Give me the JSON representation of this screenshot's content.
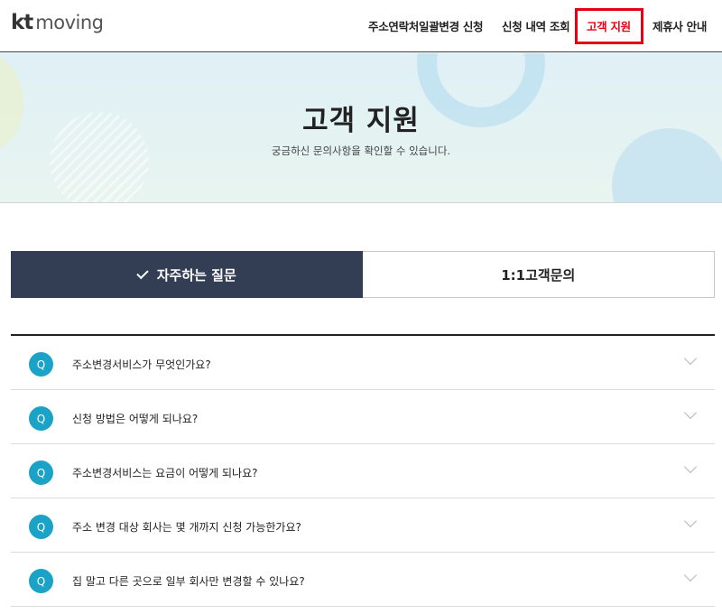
{
  "header": {
    "logo": {
      "brand": "kt",
      "product": "moving"
    },
    "nav": [
      {
        "label": "주소연락처일괄변경 신청"
      },
      {
        "label": "신청 내역 조회"
      },
      {
        "label": "고객 지원"
      },
      {
        "label": "제휴사 안내"
      }
    ],
    "accent_color": "#e60012"
  },
  "hero": {
    "title": "고객 지원",
    "subtitle": "궁금하신 문의사항을 확인할 수 있습니다."
  },
  "tabs": [
    {
      "label": "자주하는 질문",
      "selected": true
    },
    {
      "label": "1:1고객문의",
      "selected": false
    }
  ],
  "faq": {
    "badge": "Q",
    "items": [
      {
        "question": "주소변경서비스가 무엇인가요?"
      },
      {
        "question": "신청 방법은 어떻게 되나요?"
      },
      {
        "question": "주소변경서비스는 요금이 어떻게 되나요?"
      },
      {
        "question": "주소 변경 대상 회사는 몇 개까지 신청 가능한가요?"
      },
      {
        "question": "집 말고 다른 곳으로 일부 회사만 변경할 수 있나요?"
      }
    ]
  },
  "colors": {
    "tab_selected_bg": "#333d54",
    "badge_bg": "#1aa3c6"
  }
}
